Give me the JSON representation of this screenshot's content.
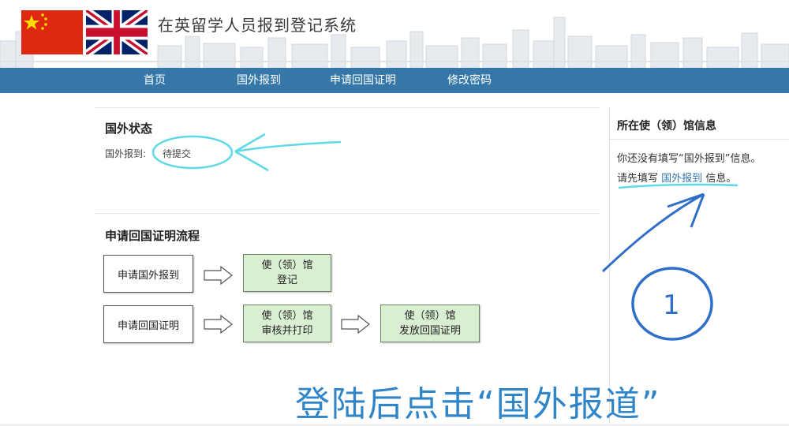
{
  "header": {
    "title": "在英留学人员报到登记系统",
    "flags": [
      "china-flag-icon",
      "uk-flag-icon"
    ]
  },
  "nav": {
    "items": [
      "首页",
      "国外报到",
      "申请回国证明",
      "修改密码"
    ]
  },
  "status": {
    "title": "国外状态",
    "label": "国外报到:",
    "value": "待提交"
  },
  "process": {
    "title": "申请回国证明流程",
    "row1": {
      "start": "申请国外报到",
      "step1": "使（领）馆\n登记"
    },
    "row2": {
      "start": "申请回国证明",
      "step1": "使（领）馆\n审核并打印",
      "step2": "使（领）馆\n发放回国证明"
    }
  },
  "sidebar": {
    "title": "所在使（领）馆信息",
    "line1": "你还没有填写“国外报到”信息。",
    "line2_prefix": "请先填写",
    "line2_link": "国外报到",
    "line2_suffix": "信息。"
  },
  "annotation": {
    "caption": "登陆后点击“国外报道”",
    "number": "1"
  },
  "colors": {
    "nav_bg": "#3577a9",
    "step_green": "#d9efd2",
    "annotation_blue": "#2f85c8",
    "highlight_cyan": "#5fd8e8"
  }
}
